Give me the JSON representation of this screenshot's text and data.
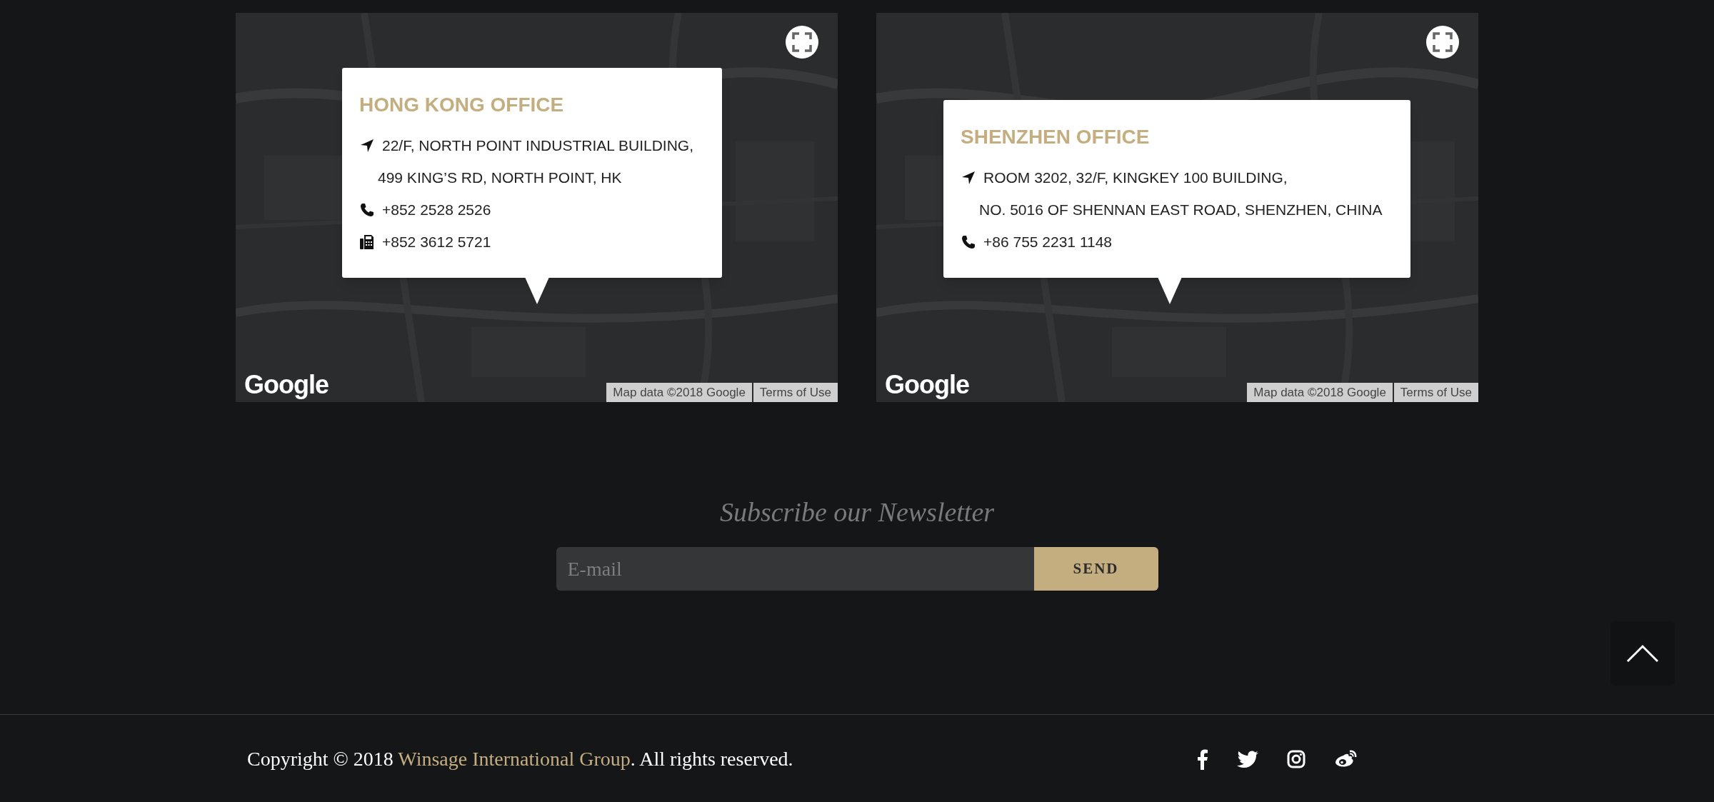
{
  "maps": [
    {
      "kind": "picture",
      "title": "HONG KONG OFFICE",
      "items": [
        {
          "kind": "address",
          "lines": [
            "22/F, NORTH POINT INDUSTRIAL BUILDING,",
            "499 KING’S RD, NORTH POINT, HK"
          ]
        },
        {
          "kind": "phone",
          "lines": [
            "+852 2528 2526"
          ]
        },
        {
          "kind": "fax",
          "lines": [
            "+852 3612 5721"
          ]
        }
      ],
      "logo": "Google",
      "attribution": "Map data ©2018 Google",
      "terms": "Terms of Use"
    },
    {
      "kind": "picture",
      "title": "SHENZHEN OFFICE",
      "items": [
        {
          "kind": "address",
          "lines": [
            "ROOM 3202, 32/F, KINGKEY 100 BUILDING,",
            "NO. 5016 OF SHENNAN EAST ROAD, SHENZHEN, CHINA"
          ]
        },
        {
          "kind": "phone",
          "lines": [
            "+86 755 2231 1148"
          ]
        }
      ],
      "logo": "Google",
      "attribution": "Map data ©2018 Google",
      "terms": "Terms of Use"
    }
  ],
  "newsletter": {
    "heading": "Subscribe our Newsletter",
    "placeholder": "E-mail",
    "button": "SEND"
  },
  "footer": {
    "copyright_prefix": "Copyright © 2018 ",
    "company_link": "Winsage International Group",
    "copyright_suffix": ". All rights reserved.",
    "social": [
      {
        "kind": "facebook"
      },
      {
        "kind": "twitter"
      },
      {
        "kind": "instagram"
      },
      {
        "kind": "weibo"
      }
    ]
  }
}
